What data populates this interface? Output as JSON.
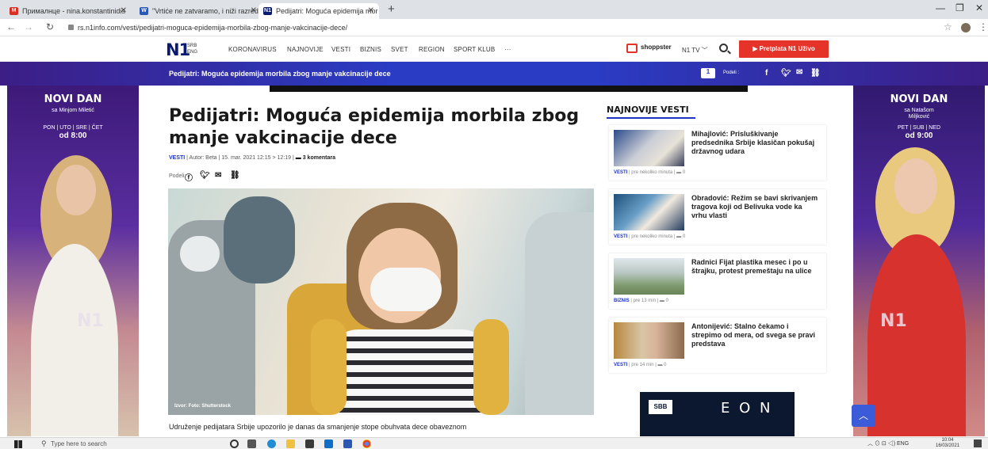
{
  "tabs": [
    {
      "label": "Прималнце - nina.konstantinidis",
      "icon": "gmail-icon",
      "active": false
    },
    {
      "label": "\"Vrtiće ne zatvaramo, i niži razred",
      "icon": "doc-icon",
      "active": false
    },
    {
      "label": "Pedijatri: Moguća epidemija mor",
      "icon": "n1-icon",
      "active": true
    }
  ],
  "address": {
    "url": "rs.n1info.com/vesti/pedijatri-moguca-epidemija-morbila-zbog-manje-vakcinacije-dece/"
  },
  "site": {
    "logo": "N1",
    "lang": "SRB",
    "lang2": "ENG",
    "nav": [
      "KORONAVIRUS",
      "NAJNOVIJE",
      "VESTI",
      "BIZNIS",
      "SVET",
      "REGION",
      "SPORT KLUB",
      "···"
    ],
    "shoppster": "shoppster",
    "n1tv": "N1 TV ﹀",
    "subscribe": "▶ Pretplata N1 Uživo"
  },
  "breaking": {
    "title": "Pedijatri: Moguća epidemija morbila zbog manje vakcinacije dece",
    "share_label": "Podeli :"
  },
  "ad_left": {
    "title": "NOVI DAN",
    "host": "sa Minjom Miletić",
    "days": "PON | UTO | SRE | ČET",
    "time": "od 8:00",
    "logo": "N1"
  },
  "ad_right": {
    "title": "NOVI DAN",
    "host": "sa Natašom Miljković",
    "days": "PET | SUB | NED",
    "time": "od 9:00",
    "logo": "N1"
  },
  "article": {
    "headline": "Pedijatri: Moguća epidemija morbila zbog manje vakcinacije dece",
    "category": "VESTI",
    "meta": " | Autor: Beta | 15. mar. 2021 12:15 > 12:19 | ",
    "comments": "3 komentara",
    "share_label": "Podeli:",
    "image_caption": "Izvor: Foto: Shutterstock",
    "body": "Udruženje pedijatara Srbije upozorilo je danas da smanjenje stope obuhvata dece obaveznom"
  },
  "sidebar": {
    "title": "NAJNOVIJE VESTI",
    "items": [
      {
        "title": "Mihajlović: Prisluškivanje predsednika Srbije klasičan pokušaj državnog udara",
        "category": "VESTI",
        "time": " | pre nekoliko minuta | ",
        "comments": "0"
      },
      {
        "title": "Obradović: Režim se bavi skrivanjem tragova koji od Belivuka vode ka vrhu vlasti",
        "category": "VESTI",
        "time": " | pre nekoliko minuta | ",
        "comments": "0"
      },
      {
        "title": "Radnici Fijat plastika mesec i po u štrajku, protest premeštaju na ulice",
        "category": "BIZNIS",
        "time": " | pre 13 min | ",
        "comments": "0"
      },
      {
        "title": "Antonijević: Stalno čekamo i strepimo od mera, od svega se pravi predstava",
        "category": "VESTI",
        "time": " | pre 14 min | ",
        "comments": "0"
      }
    ],
    "ad": {
      "brand": "SBB",
      "product": "E O N"
    }
  },
  "taskbar": {
    "search_placeholder": "Type here to search",
    "lang": "ENG",
    "time": "10:04",
    "date": "16/03/2021"
  },
  "colors": {
    "brand_blue": "#1c33c3",
    "red": "#e6332a",
    "navy": "#0a1a6e"
  }
}
